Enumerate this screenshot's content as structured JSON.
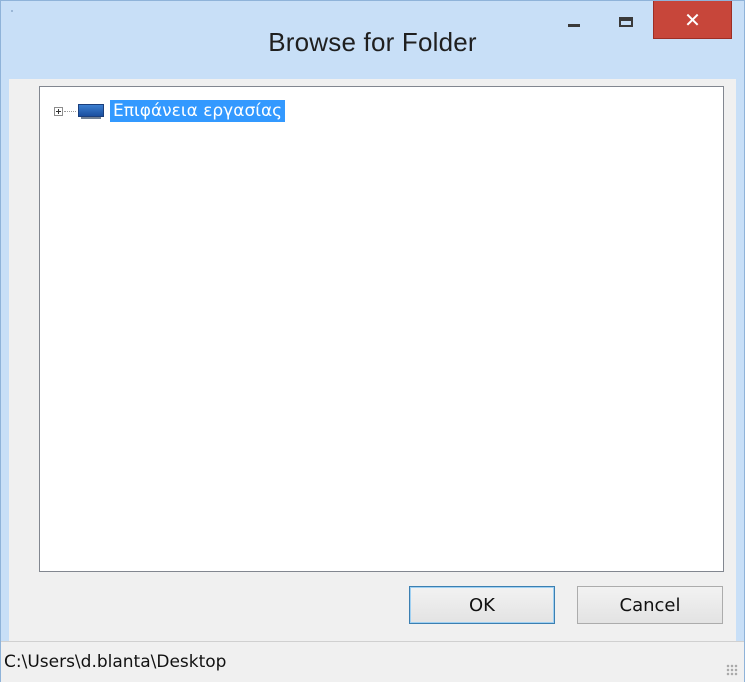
{
  "window": {
    "title": "Browse for Folder",
    "close_icon": "close-icon",
    "minimize_icon": "minimize-icon",
    "maximize_icon": "maximize-icon"
  },
  "tree": {
    "items": [
      {
        "label": "Επιφάνεια εργασίας",
        "icon": "desktop-icon",
        "expanded": false,
        "selected": true
      }
    ]
  },
  "buttons": {
    "ok_label": "OK",
    "cancel_label": "Cancel"
  },
  "status": {
    "path": "C:\\Users\\d.blanta\\Desktop"
  },
  "colors": {
    "selection": "#3399ff",
    "close_button": "#c7463a",
    "window_frame": "#c8dff7"
  }
}
